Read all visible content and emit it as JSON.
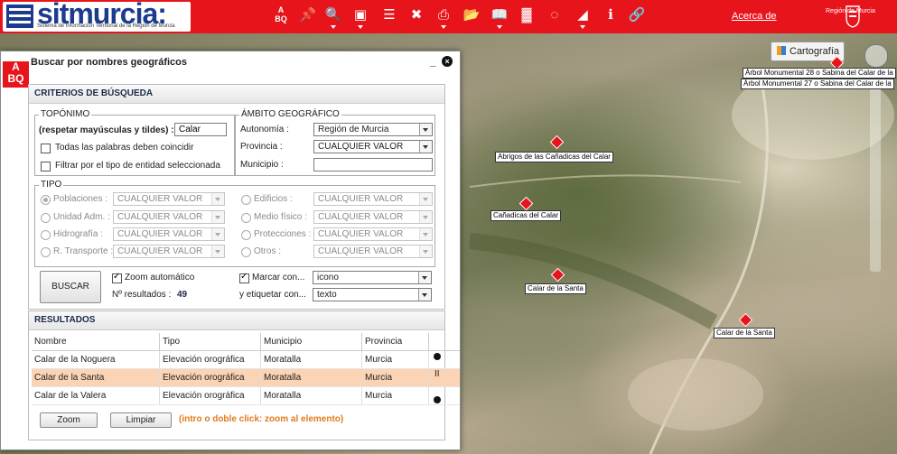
{
  "header": {
    "logo_text": "sitmurcia:",
    "logo_subtitle": "Sistema de Información Territorial de la Región de Murcia",
    "acerca_label": "Acerca de",
    "region_label": "Región de Murcia",
    "tool_icons": [
      "abc-search-icon",
      "pin-icon",
      "zoom-icon",
      "layers-icon",
      "bookmark-icon",
      "tools-icon",
      "print-icon",
      "folder-icon",
      "book-icon",
      "chart-icon",
      "loading-icon",
      "profile-icon",
      "info-icon",
      "link-icon"
    ]
  },
  "map": {
    "cartografia_label": "Cartografía",
    "labels": [
      "Árbol Monumental 28 o Sabina del Calar de la",
      "Árbol Monumental 27 o Sabina del Calar de la",
      "Abrigos de las Cañadicas del Calar",
      "Cañadicas del Calar",
      "Calar de la Santa",
      "Calar de la Santa"
    ]
  },
  "dialog": {
    "title": "Buscar por nombres geográficos",
    "icon_text_top": "A",
    "icon_text_bottom": "BQ",
    "minimize": "_",
    "close": "×",
    "criterios": {
      "heading": "CRITERIOS DE BÚSQUEDA",
      "toponimo": {
        "legend": "TOPÓNIMO",
        "label": "(respetar mayúsculas y tildes) :",
        "value": "Calar",
        "chk_all_words": "Todas las palabras deben coincidir",
        "chk_filter_type": "Filtrar por el tipo de entidad seleccionada"
      },
      "ambito": {
        "legend": "ÁMBITO GEOGRÁFICO",
        "autonomia_label": "Autonomía :",
        "autonomia_value": "Región de Murcia",
        "provincia_label": "Provincia :",
        "provincia_value": "CUALQUIER VALOR",
        "municipio_label": "Municipio :",
        "municipio_value": ""
      },
      "tipo": {
        "legend": "TIPO",
        "items": [
          {
            "label": "Poblaciones :",
            "value": "CUALQUIER VALOR"
          },
          {
            "label": "Unidad Adm. :",
            "value": "CUALQUIER VALOR"
          },
          {
            "label": "Hidrografía :",
            "value": "CUALQUIER VALOR"
          },
          {
            "label": "R. Transporte :",
            "value": "CUALQUIER VALOR"
          },
          {
            "label": "Edificios :",
            "value": "CUALQUIER VALOR"
          },
          {
            "label": "Medio físico :",
            "value": "CUALQUIER VALOR"
          },
          {
            "label": "Protecciones :",
            "value": "CUALQUIER VALOR"
          },
          {
            "label": "Otros :",
            "value": "CUALQUIER VALOR"
          }
        ]
      },
      "buscar_label": "BUSCAR",
      "zoom_auto_label": "Zoom automático",
      "nresultados_label": "Nº resultados :",
      "nresultados_value": "49",
      "marcar_label": "Marcar con...",
      "marcar_value": "icono",
      "etiquetar_label": "y etiquetar con...",
      "etiquetar_value": "texto"
    },
    "resultados": {
      "heading": "RESULTADOS",
      "columns": [
        "Nombre",
        "Tipo",
        "Municipio",
        "Provincia"
      ],
      "rows": [
        [
          "Calar de la Noguera",
          "Elevación orográfica",
          "Moratalla",
          "Murcia"
        ],
        [
          "Calar de la Santa",
          "Elevación orográfica",
          "Moratalla",
          "Murcia"
        ],
        [
          "Calar de la Valera",
          "Elevación orográfica",
          "Moratalla",
          "Murcia"
        ]
      ],
      "scroll_mid": "II",
      "zoom_label": "Zoom",
      "limpiar_label": "Limpiar",
      "hint": "(intro o doble click: zoom al elemento)"
    }
  }
}
